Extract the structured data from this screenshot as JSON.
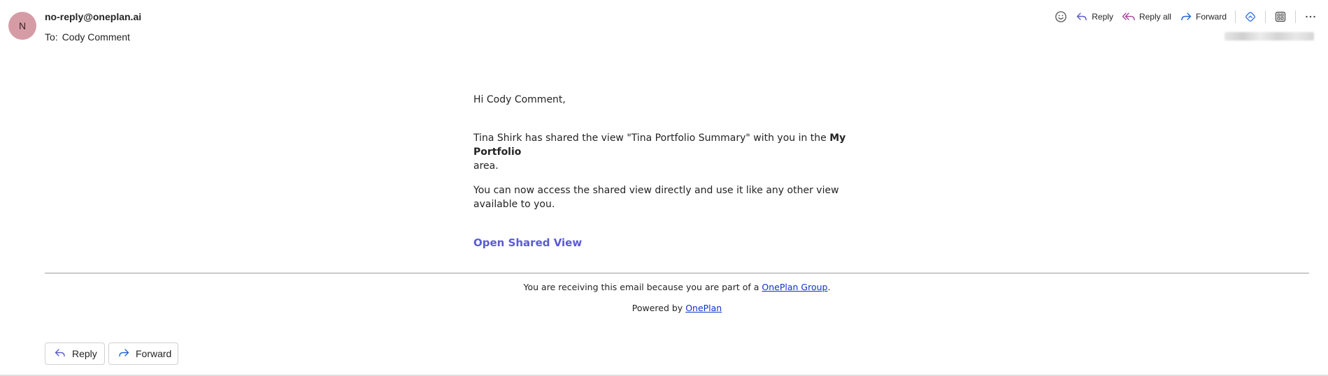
{
  "message": {
    "avatar_initial": "N",
    "sender": "no-reply@oneplan.ai",
    "to_label": "To:",
    "to_name": "Cody Comment"
  },
  "toolbar": {
    "reply_label": "Reply",
    "reply_all_label": "Reply all",
    "forward_label": "Forward"
  },
  "body": {
    "greeting": "Hi Cody Comment,",
    "shared_text": "Tina Shirk has shared the view \"Tina Portfolio Summary\" with you in the ",
    "area_name": "My Portfolio",
    "area_suffix": "area.",
    "access_text": "You can now access the shared view directly and use it like any other view available to you.",
    "open_link": "Open Shared View"
  },
  "footer": {
    "receiving_prefix": "You are receiving this email because you are part of a ",
    "group_link": "OnePlan Group",
    "receiving_suffix": ".",
    "powered_prefix": "Powered by ",
    "powered_link": "OnePlan"
  },
  "bottom_actions": {
    "reply_label": "Reply",
    "forward_label": "Forward"
  },
  "colors": {
    "avatar_bg": "#d69ca5",
    "link_purple": "#5b5bd6",
    "link_blue": "#0b34c9",
    "reply_icon": "#5b5fc7",
    "reply_all_icon": "#a23a9e",
    "forward_icon": "#2266d6"
  },
  "icons": [
    "emoji-icon",
    "reply-icon",
    "reply-all-icon",
    "forward-icon",
    "loop-icon",
    "apps-icon",
    "more-icon"
  ]
}
